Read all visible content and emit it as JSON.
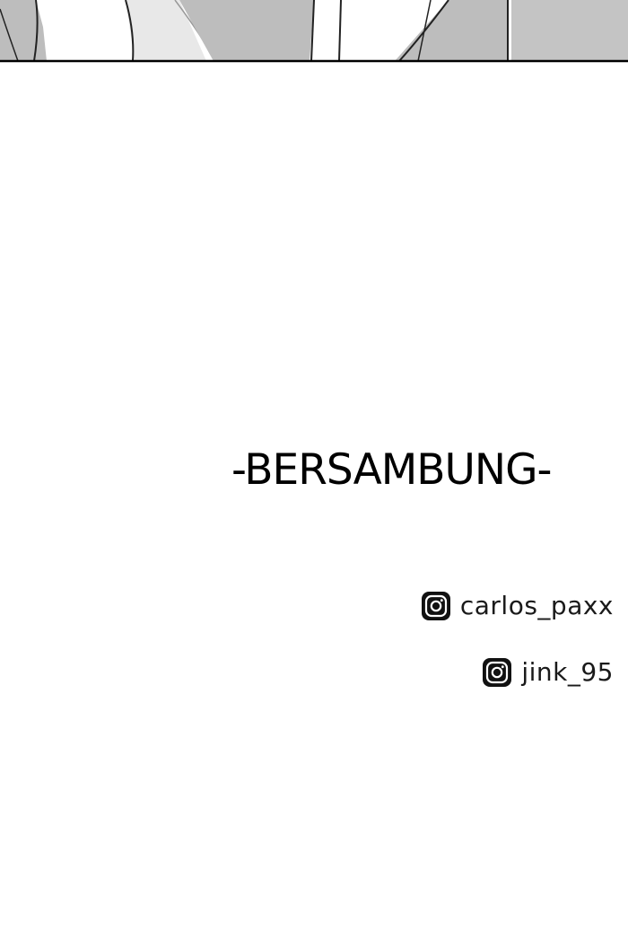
{
  "continuation_text": "-BERSAMBUNG-",
  "credits": [
    {
      "icon": "instagram-icon",
      "handle": "carlos_paxx"
    },
    {
      "icon": "instagram-icon",
      "handle": "jink_95"
    }
  ],
  "colors": {
    "background": "#ffffff",
    "text": "#000000",
    "panel_gray": "#b9b9b9",
    "panel_border": "#000000"
  }
}
